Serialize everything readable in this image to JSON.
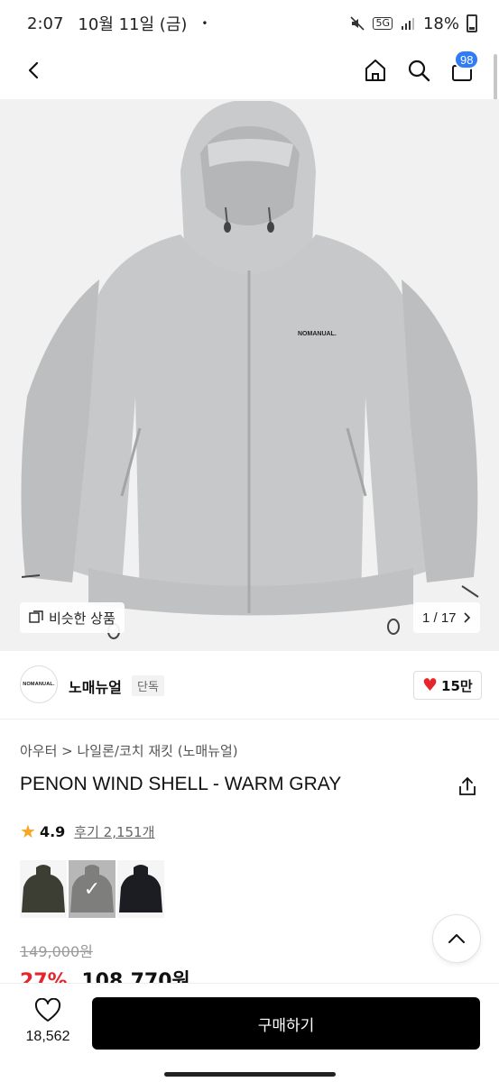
{
  "status_bar": {
    "time": "2:07",
    "date": "10월 11일 (금)",
    "dot": "•",
    "network": "5G",
    "battery": "18%"
  },
  "nav": {
    "back_icon": "chevron-left-icon",
    "home_icon": "home-icon",
    "search_icon": "search-icon",
    "cart_icon": "bag-icon",
    "cart_count": "98",
    "badge_color": "#2f7cf6"
  },
  "gallery": {
    "brand_mark": "NOMANUAL.",
    "similar_label": "비슷한 상품",
    "counter": "1 / 17"
  },
  "brand": {
    "logo_text": "NOMANUAL.",
    "name": "노매뉴얼",
    "tag": "단독",
    "likes": "15만"
  },
  "product": {
    "breadcrumb": "아우터 > 나일론/코치 재킷 (노매뉴얼)",
    "title": "PENON WIND SHELL - WARM GRAY",
    "rating": "4.9",
    "reviews": "후기 2,151개",
    "colors": [
      {
        "name": "olive",
        "hex": "#3c3d33",
        "selected": false
      },
      {
        "name": "warm-gray",
        "hex": "#a8a8a6",
        "selected": true
      },
      {
        "name": "black",
        "hex": "#1c1d22",
        "selected": false
      }
    ],
    "original_price": "149,000원",
    "discount": "27%",
    "sale_price": "108,770원"
  },
  "bottom": {
    "wish_count": "18,562",
    "buy_label": "구매하기"
  },
  "colors": {
    "accent_red": "#e5242c",
    "primary_button": "#000000"
  }
}
